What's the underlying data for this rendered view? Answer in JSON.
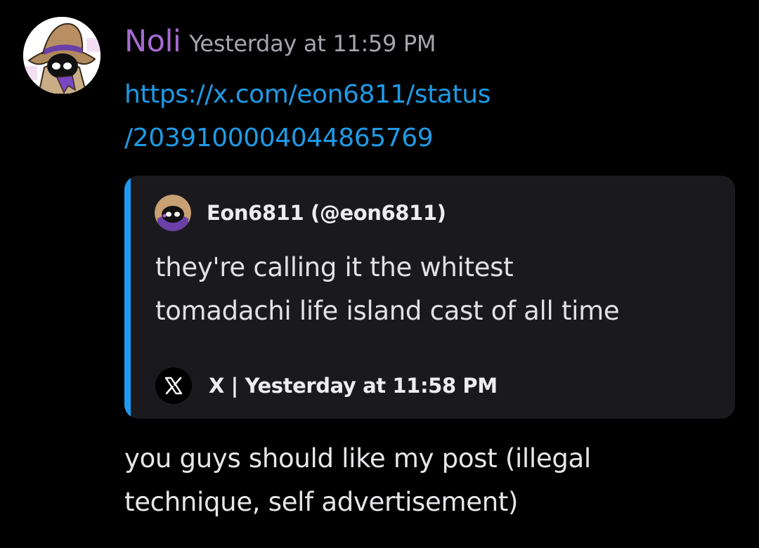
{
  "message": {
    "author": "Noli",
    "author_color": "#a66bd1",
    "timestamp": "Yesterday at 11:59 PM",
    "link": {
      "line1": "https://x.com/eon6811/status",
      "line2": "/2039100004044865769",
      "color": "#1f9be6"
    },
    "embed": {
      "accent_color": "#1d9bf0",
      "author": "Eon6811 (@eon6811)",
      "text_lines": [
        "they're calling it the whitest",
        "tomadachi life island cast of all time"
      ],
      "footer": "X | Yesterday at 11:58 PM",
      "footer_icon": "x-logo-icon"
    },
    "content_lines": [
      "you guys should like my post (illegal",
      "technique, self advertisement)"
    ]
  }
}
